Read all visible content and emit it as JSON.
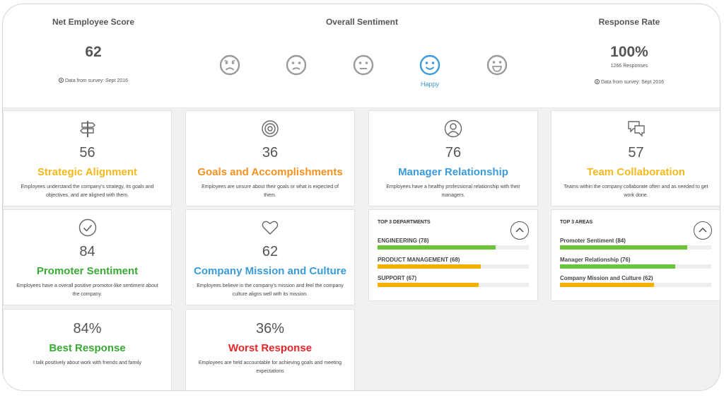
{
  "summary": {
    "nes": {
      "title": "Net Employee Score",
      "value": "62",
      "note": "Data from survey: Sept 2016"
    },
    "sentiment": {
      "title": "Overall Sentiment",
      "faces": [
        {
          "name": "very-unhappy",
          "color": "#9a9a9a",
          "selected": false
        },
        {
          "name": "unhappy",
          "color": "#9a9a9a",
          "selected": false
        },
        {
          "name": "neutral",
          "color": "#9a9a9a",
          "selected": false
        },
        {
          "name": "happy",
          "color": "#3a9bd9",
          "selected": true
        },
        {
          "name": "very-happy",
          "color": "#9a9a9a",
          "selected": false
        }
      ],
      "selected_label": "Happy"
    },
    "response": {
      "title": "Response Rate",
      "value": "100%",
      "responses": "1266 Responses",
      "note": "Data from survey: Sept 2016"
    }
  },
  "cards": {
    "strategic": {
      "score": "56",
      "name": "Strategic Alignment",
      "color": "#f5b91c",
      "icon": "signpost-icon",
      "desc": "Employees understand the company's strategy, its goals and objectives, and are aligned with them."
    },
    "goals": {
      "score": "36",
      "name": "Goals and Accomplishments",
      "color": "#f39221",
      "icon": "target-icon",
      "desc": "Employees are unsure about their goals or what is expected of them."
    },
    "manager": {
      "score": "76",
      "name": "Manager Relationship",
      "color": "#3a9bd9",
      "icon": "person-icon",
      "desc": "Employees have a healthy professional relationship with their managers."
    },
    "team": {
      "score": "57",
      "name": "Team Collaboration",
      "color": "#f5b91c",
      "icon": "chat-bubbles-icon",
      "desc": "Teams within the company collaborate often and as needed to get work done."
    },
    "promoter": {
      "score": "84",
      "name": "Promoter Sentiment",
      "color": "#3aaa35",
      "icon": "checkmark-icon",
      "desc": "Employees have a overall positive promotor-like sentiment about the company."
    },
    "mission": {
      "score": "62",
      "name": "Company Mission and Culture",
      "color": "#3a9bd9",
      "icon": "heart-icon",
      "desc": "Employees believe in the company's mission and feel the company culture aligns well with its mission."
    },
    "best": {
      "score": "84%",
      "name": "Best Response",
      "color": "#3aaa35",
      "desc": "I talk positively about work with friends and family"
    },
    "worst": {
      "score": "36%",
      "name": "Worst Response",
      "color": "#e8262a",
      "desc": "Employees are held accountable for achieving goals and meeting expectations"
    }
  },
  "top_departments": {
    "title": "TOP 3 DEPARTMENTS",
    "items": [
      {
        "label": "ENGINEERING (78)",
        "value": 78,
        "color": "#6ac43a"
      },
      {
        "label": "PRODUCT MANAGEMENT (68)",
        "value": 68,
        "color": "#f5b000"
      },
      {
        "label": "SUPPORT (67)",
        "value": 67,
        "color": "#f5b000"
      }
    ]
  },
  "top_areas": {
    "title": "TOP 3 AREAS",
    "items": [
      {
        "label": "Promoter Sentiment (84)",
        "value": 84,
        "color": "#6ac43a"
      },
      {
        "label": "Manager Relationship (76)",
        "value": 76,
        "color": "#6ac43a"
      },
      {
        "label": "Company Mission and Culture (62)",
        "value": 62,
        "color": "#f5b000"
      }
    ]
  }
}
